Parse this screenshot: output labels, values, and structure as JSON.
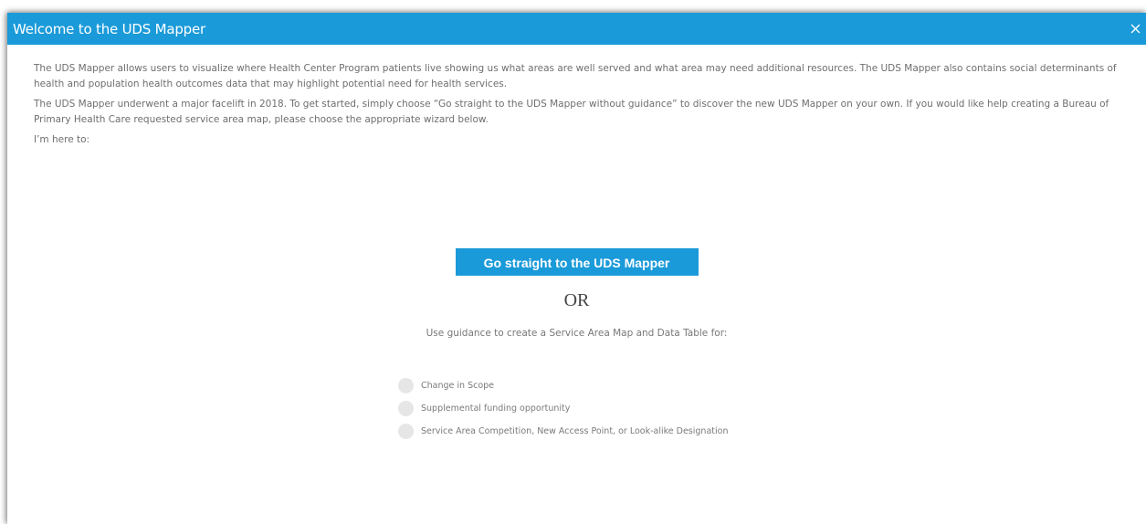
{
  "dialog": {
    "title": "Welcome to the UDS Mapper",
    "close_icon": "close-icon"
  },
  "intro": {
    "paragraph1": "The UDS Mapper allows users to visualize where Health Center Program patients live showing us what areas are well served and what area may need additional resources. The UDS Mapper also contains social determinants of health and population health outcomes data that may highlight potential need for health services.",
    "paragraph2": "The UDS Mapper underwent a major facelift in 2018. To get started, simply choose “Go straight to the UDS Mapper without guidance” to discover the new UDS Mapper on your own. If you would like help creating a Bureau of Primary Health Care requested service area map, please choose the appropriate wizard below.",
    "prompt": "I’m here to:"
  },
  "actions": {
    "go_button_label": "Go straight to the UDS Mapper",
    "or_label": "OR",
    "guidance_label": "Use guidance to create a Service Area Map and Data Table for:"
  },
  "options": [
    {
      "label": "Change in Scope",
      "selected": false
    },
    {
      "label": "Supplemental funding opportunity",
      "selected": false
    },
    {
      "label": "Service Area Competition, New Access Point, or Look-alike Designation",
      "selected": false
    }
  ],
  "colors": {
    "accent": "#1a9ad9",
    "text": "#6e6e6e",
    "radio": "#e6e6e6"
  }
}
